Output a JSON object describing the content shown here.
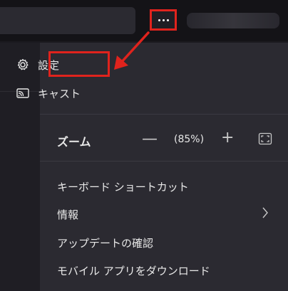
{
  "menu": {
    "more_button_icon": "more-horizontal-icon",
    "settings": {
      "label": "設定",
      "icon": "gear-icon"
    },
    "cast": {
      "label": "キャスト",
      "icon": "cast-icon"
    },
    "zoom": {
      "label": "ズーム",
      "minus": "—",
      "value": "(85%)",
      "plus": "+",
      "fullscreen_icon": "fullscreen-icon"
    },
    "items": [
      {
        "label": "キーボード ショートカット"
      },
      {
        "label": "情報",
        "icon": "chevron-right-icon"
      },
      {
        "label": "アップデートの確認"
      },
      {
        "label": "モバイル アプリをダウンロード"
      }
    ]
  },
  "annotations": {
    "highlight_color": "#e0231d"
  }
}
